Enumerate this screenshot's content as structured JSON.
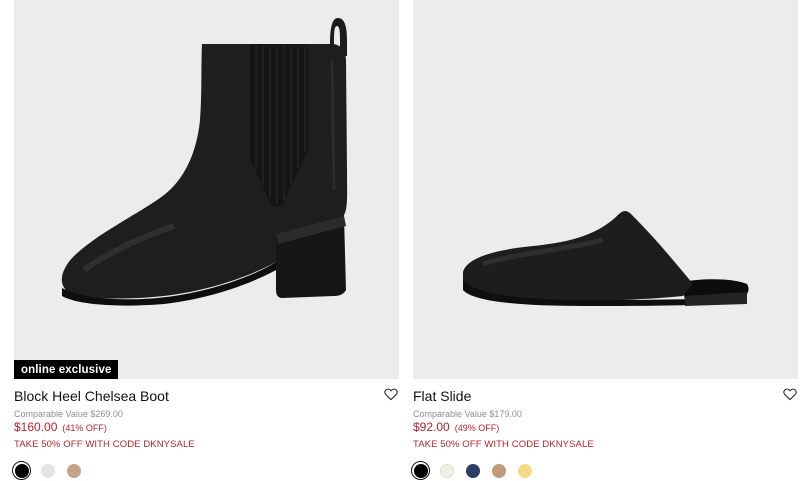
{
  "products": [
    {
      "badge": "online exclusive",
      "title": "Block Heel Chelsea Boot",
      "comparable": "Comparable Value $269.00",
      "price": "$160.00",
      "discount": "(41% OFF)",
      "promo": "TAKE 50% OFF WITH CODE DKNYSALE",
      "wishlist_icon": "heart-outline-icon",
      "swatches": [
        "#000000",
        "#e8e3df",
        "#c4a588"
      ],
      "selected_swatch": 0
    },
    {
      "badge": "",
      "title": "Flat Slide",
      "comparable": "Comparable Value $179.00",
      "price": "$92.00",
      "discount": "(49% OFF)",
      "promo": "TAKE 50% OFF WITH CODE DKNYSALE",
      "wishlist_icon": "heart-outline-icon",
      "swatches": [
        "#000000",
        "#f2efe7",
        "#2c3e66",
        "#c09a79",
        "#f2dc8a"
      ],
      "selected_swatch": 0
    }
  ]
}
